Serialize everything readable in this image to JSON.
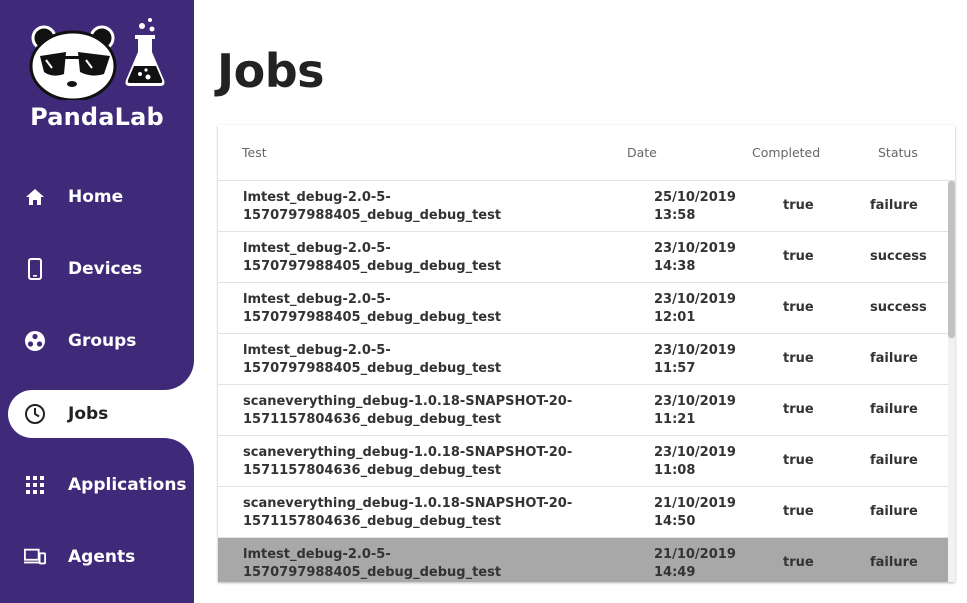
{
  "app": {
    "name": "PandaLab"
  },
  "sidebar": {
    "items": [
      {
        "label": "Home",
        "icon": "home-icon"
      },
      {
        "label": "Devices",
        "icon": "phone-icon"
      },
      {
        "label": "Groups",
        "icon": "groups-icon"
      },
      {
        "label": "Jobs",
        "icon": "clock-icon",
        "active": true
      },
      {
        "label": "Applications",
        "icon": "apps-grid-icon"
      },
      {
        "label": "Agents",
        "icon": "devices-icon"
      }
    ]
  },
  "page": {
    "title": "Jobs"
  },
  "table": {
    "headers": {
      "test": "Test",
      "date": "Date",
      "completed": "Completed",
      "status": "Status"
    },
    "rows": [
      {
        "test_l1": "lmtest_debug-2.0-5-",
        "test_l2": "1570797988405_debug_debug_test",
        "date_l1": "25/10/2019",
        "date_l2": "13:58",
        "completed": "true",
        "status": "failure"
      },
      {
        "test_l1": "lmtest_debug-2.0-5-",
        "test_l2": "1570797988405_debug_debug_test",
        "date_l1": "23/10/2019",
        "date_l2": "14:38",
        "completed": "true",
        "status": "success"
      },
      {
        "test_l1": "lmtest_debug-2.0-5-",
        "test_l2": "1570797988405_debug_debug_test",
        "date_l1": "23/10/2019",
        "date_l2": "12:01",
        "completed": "true",
        "status": "success"
      },
      {
        "test_l1": "lmtest_debug-2.0-5-",
        "test_l2": "1570797988405_debug_debug_test",
        "date_l1": "23/10/2019",
        "date_l2": "11:57",
        "completed": "true",
        "status": "failure"
      },
      {
        "test_l1": "scaneverything_debug-1.0.18-SNAPSHOT-20-",
        "test_l2": "1571157804636_debug_debug_test",
        "date_l1": "23/10/2019",
        "date_l2": "11:21",
        "completed": "true",
        "status": "failure"
      },
      {
        "test_l1": "scaneverything_debug-1.0.18-SNAPSHOT-20-",
        "test_l2": "1571157804636_debug_debug_test",
        "date_l1": "23/10/2019",
        "date_l2": "11:08",
        "completed": "true",
        "status": "failure"
      },
      {
        "test_l1": "scaneverything_debug-1.0.18-SNAPSHOT-20-",
        "test_l2": "1571157804636_debug_debug_test",
        "date_l1": "21/10/2019",
        "date_l2": "14:50",
        "completed": "true",
        "status": "failure"
      },
      {
        "test_l1": "lmtest_debug-2.0-5-",
        "test_l2": "1570797988405_debug_debug_test",
        "date_l1": "21/10/2019",
        "date_l2": "14:49",
        "completed": "true",
        "status": "failure",
        "selected": true
      }
    ]
  },
  "colors": {
    "sidebar_bg": "#3e2a78",
    "selected_row": "#a8a8a8"
  }
}
